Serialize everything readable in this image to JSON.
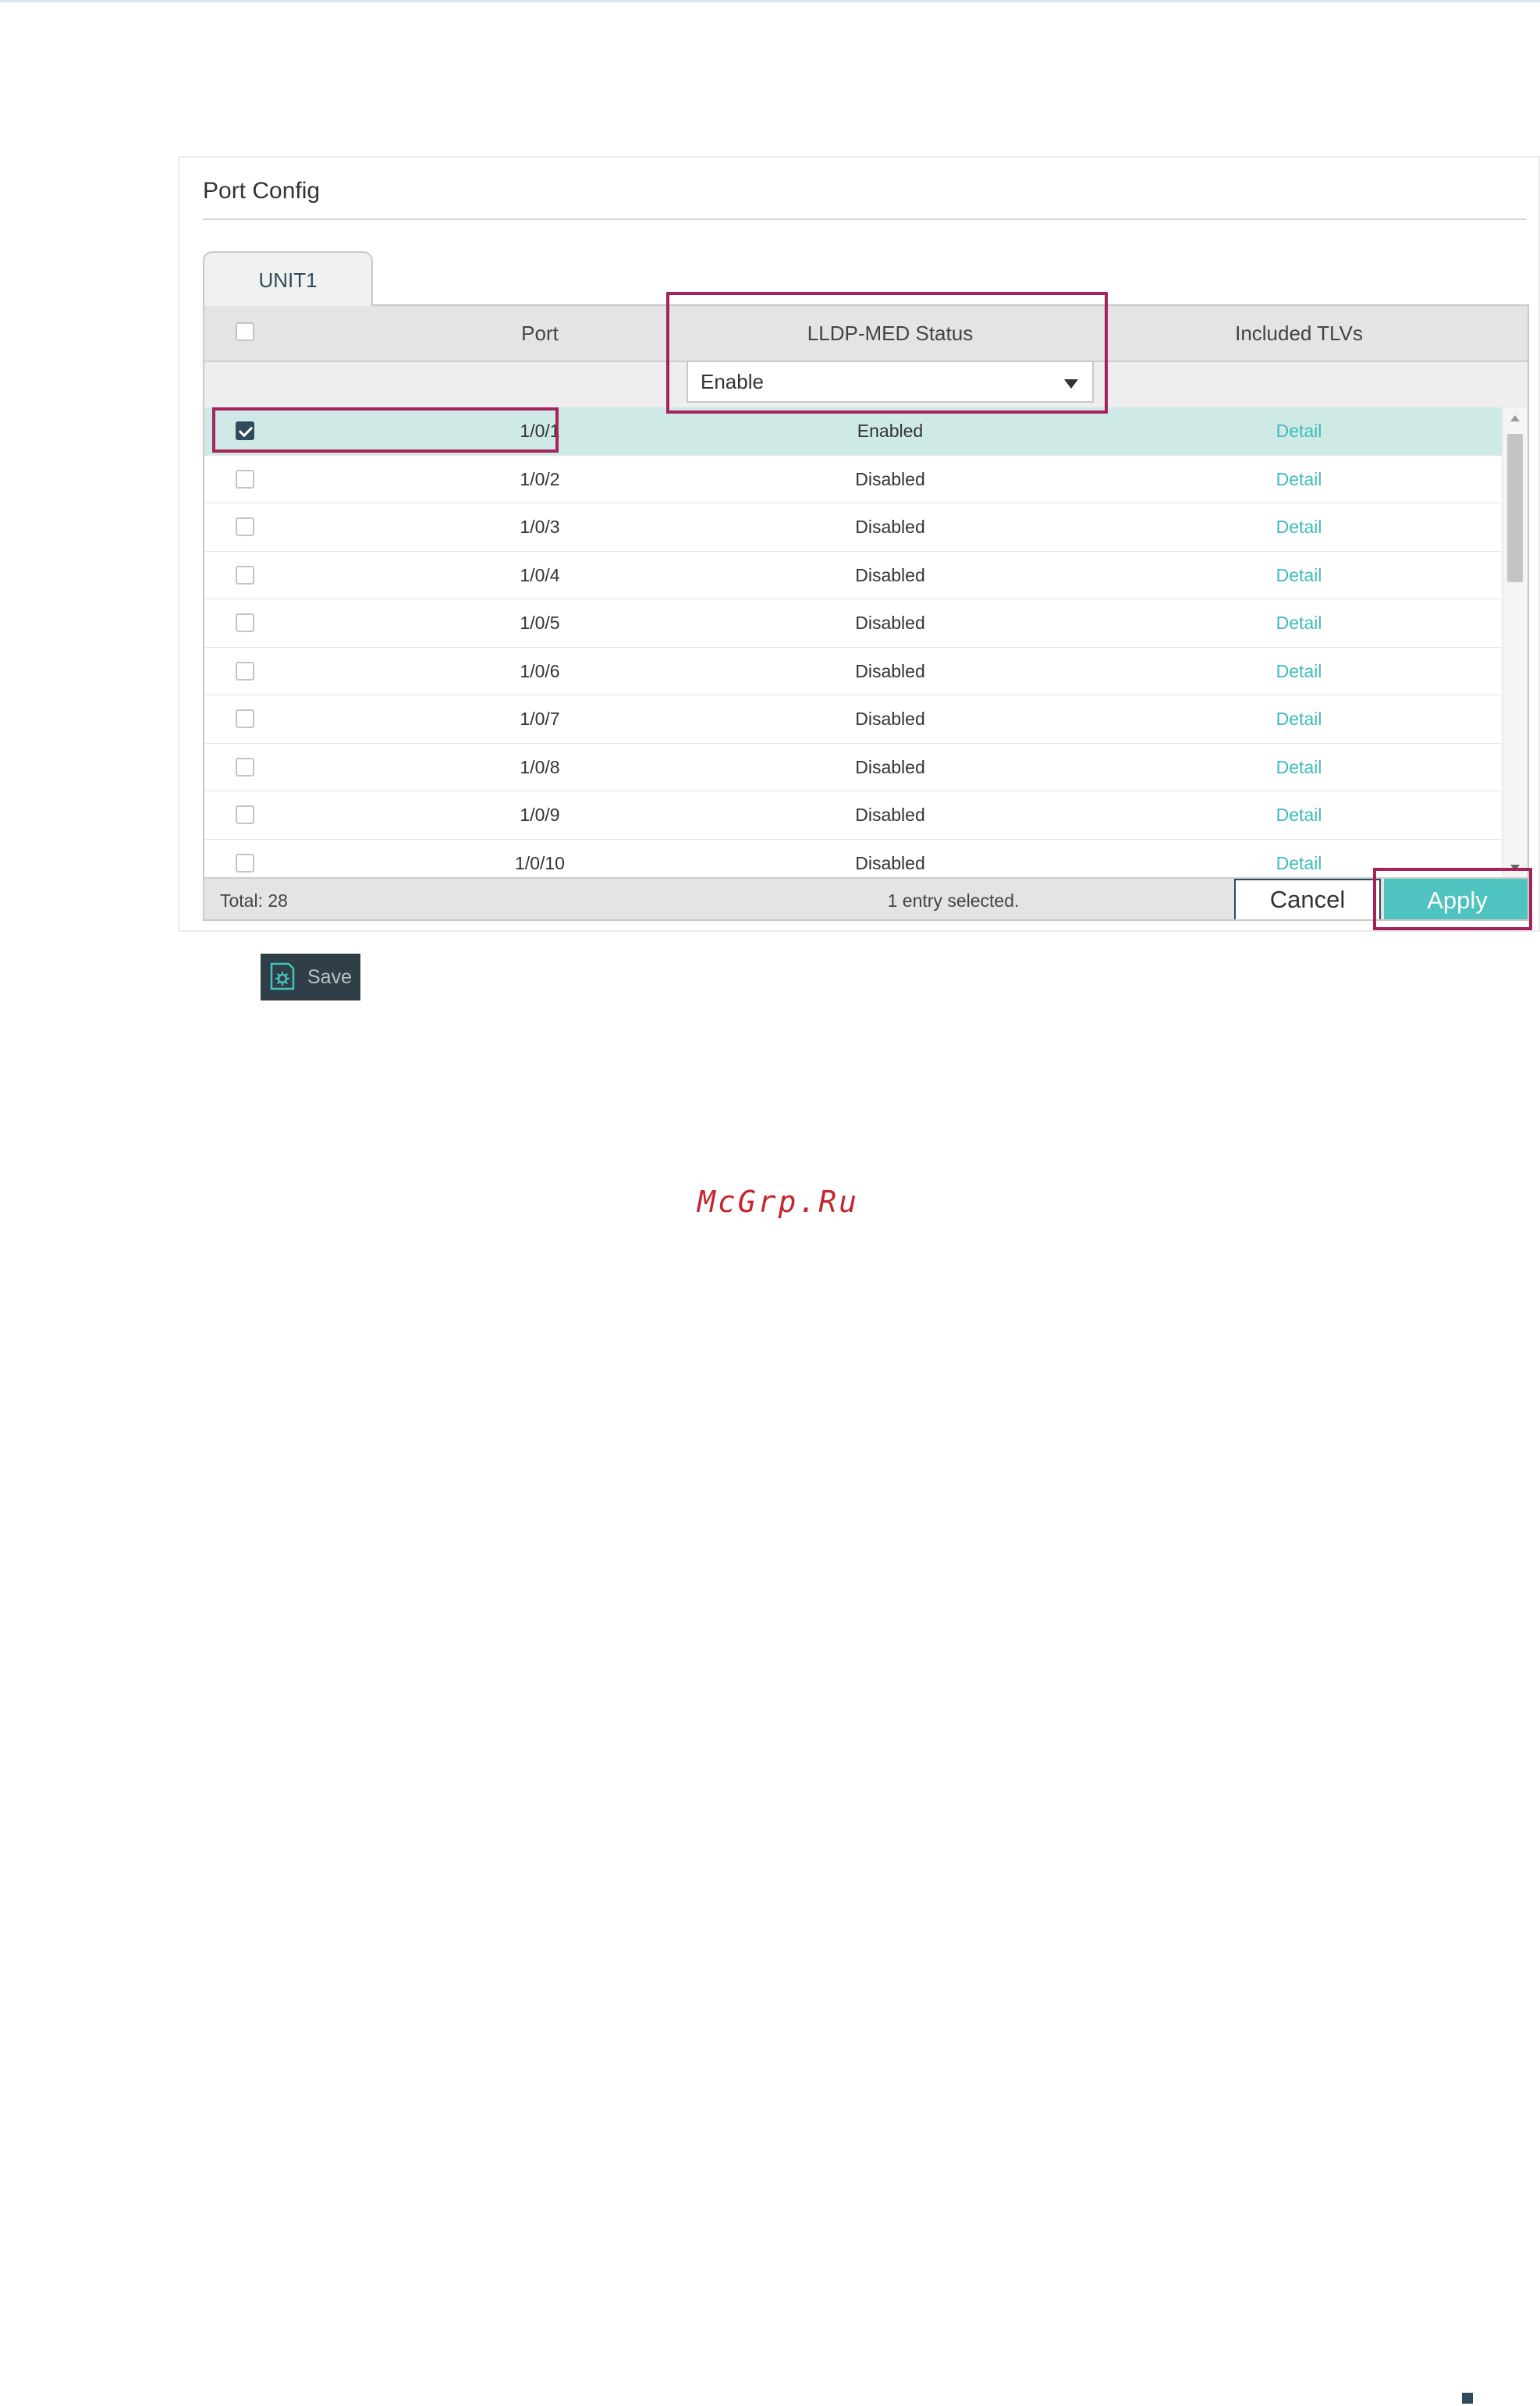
{
  "panel": {
    "title": "Port Config"
  },
  "tabs": [
    {
      "label": "UNIT1",
      "active": true
    }
  ],
  "table": {
    "columns": {
      "port": "Port",
      "status": "LLDP-MED Status",
      "tlvs": "Included TLVs"
    },
    "filter": {
      "status_value": "Enable"
    },
    "rows": [
      {
        "port": "1/0/1",
        "status": "Enabled",
        "tlv": "Detail",
        "checked": true
      },
      {
        "port": "1/0/2",
        "status": "Disabled",
        "tlv": "Detail",
        "checked": false
      },
      {
        "port": "1/0/3",
        "status": "Disabled",
        "tlv": "Detail",
        "checked": false
      },
      {
        "port": "1/0/4",
        "status": "Disabled",
        "tlv": "Detail",
        "checked": false
      },
      {
        "port": "1/0/5",
        "status": "Disabled",
        "tlv": "Detail",
        "checked": false
      },
      {
        "port": "1/0/6",
        "status": "Disabled",
        "tlv": "Detail",
        "checked": false
      },
      {
        "port": "1/0/7",
        "status": "Disabled",
        "tlv": "Detail",
        "checked": false
      },
      {
        "port": "1/0/8",
        "status": "Disabled",
        "tlv": "Detail",
        "checked": false
      },
      {
        "port": "1/0/9",
        "status": "Disabled",
        "tlv": "Detail",
        "checked": false
      },
      {
        "port": "1/0/10",
        "status": "Disabled",
        "tlv": "Detail",
        "checked": false
      }
    ],
    "footer": {
      "total": "Total: 28",
      "selected": "1 entry selected."
    }
  },
  "buttons": {
    "cancel": "Cancel",
    "apply": "Apply",
    "save": "Save"
  },
  "watermark": "McGrp.Ru",
  "colors": {
    "accent": "#4fc3bf",
    "highlight": "#a6225d",
    "link": "#3ebdb5",
    "selected_row": "#cfeae6",
    "dark": "#2f4a5a"
  }
}
